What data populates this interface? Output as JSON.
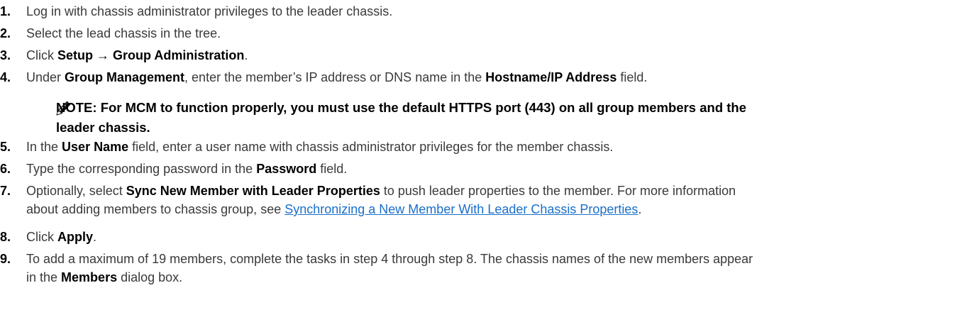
{
  "steps": [
    {
      "num": "1.",
      "parts": [
        {
          "t": "Log in with chassis administrator privileges to the leader chassis."
        }
      ]
    },
    {
      "num": "2.",
      "parts": [
        {
          "t": "Select the lead chassis in the tree."
        }
      ]
    },
    {
      "num": "3.",
      "parts": [
        {
          "t": "Click "
        },
        {
          "t": "Setup → Group Administration",
          "b": true
        },
        {
          "t": "."
        }
      ]
    },
    {
      "num": "4.",
      "parts": [
        {
          "t": "Under "
        },
        {
          "t": "Group Management",
          "b": true
        },
        {
          "t": ", enter the member’s IP address or DNS name in the "
        },
        {
          "t": "Hostname/IP Address",
          "b": true
        },
        {
          "t": " field."
        }
      ]
    },
    {
      "num": "5.",
      "parts": [
        {
          "t": "In the "
        },
        {
          "t": "User Name",
          "b": true
        },
        {
          "t": " field, enter a user name with chassis administrator privileges for the member chassis."
        }
      ]
    },
    {
      "num": "6.",
      "parts": [
        {
          "t": "Type the corresponding password in the "
        },
        {
          "t": "Password",
          "b": true
        },
        {
          "t": " field."
        }
      ]
    },
    {
      "num": "7.",
      "parts": [
        {
          "t": "Optionally, select "
        },
        {
          "t": "Sync New Member with Leader Properties",
          "b": true
        },
        {
          "t": " to push leader properties to the member. For more information"
        }
      ],
      "line2": [
        {
          "t": "about adding members to chassis group, see "
        },
        {
          "t": "Synchronizing a New Member With Leader Chassis Properties",
          "link": true
        },
        {
          "t": "."
        }
      ]
    },
    {
      "num": "8.",
      "parts": [
        {
          "t": "Click "
        },
        {
          "t": "Apply",
          "b": true
        },
        {
          "t": "."
        }
      ]
    },
    {
      "num": "9.",
      "parts": [
        {
          "t": "To add a maximum of 19 members, complete the tasks in step 4 through step 8. The chassis names of the new members appear"
        }
      ],
      "line2": [
        {
          "t": "in the "
        },
        {
          "t": "Members",
          "b": true
        },
        {
          "t": " dialog box."
        }
      ]
    }
  ],
  "note": {
    "line1": "NOTE: For MCM to function properly, you must use the default HTTPS port (443) on all group members and the",
    "line2": "leader chassis.",
    "icon": "pencil-note-icon"
  }
}
